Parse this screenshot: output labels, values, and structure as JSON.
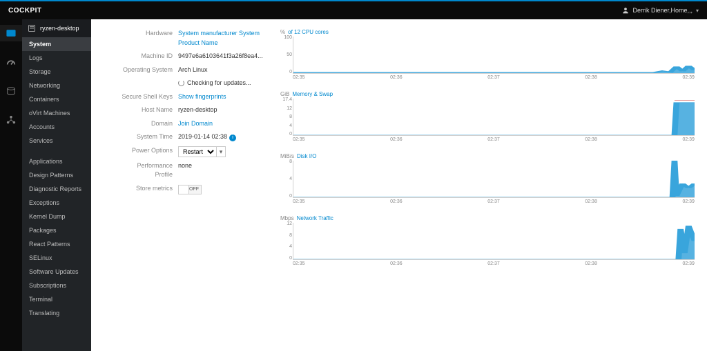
{
  "brand": "COCKPIT",
  "user": {
    "name": "Derrik Diener,Home,,,"
  },
  "sidebar": {
    "hostname": "ryzen-desktop",
    "items": [
      {
        "label": "System",
        "selected": true
      },
      {
        "label": "Logs"
      },
      {
        "label": "Storage"
      },
      {
        "label": "Networking"
      },
      {
        "label": "Containers"
      },
      {
        "label": "oVirt Machines"
      },
      {
        "label": "Accounts"
      },
      {
        "label": "Services"
      },
      {
        "label": "Applications"
      },
      {
        "label": "Design Patterns"
      },
      {
        "label": "Diagnostic Reports"
      },
      {
        "label": "Exceptions"
      },
      {
        "label": "Kernel Dump"
      },
      {
        "label": "Packages"
      },
      {
        "label": "React Patterns"
      },
      {
        "label": "SELinux"
      },
      {
        "label": "Software Updates"
      },
      {
        "label": "Subscriptions"
      },
      {
        "label": "Terminal"
      },
      {
        "label": "Translating"
      }
    ]
  },
  "info": {
    "hardware": {
      "label": "Hardware",
      "value": "System manufacturer System Product Name"
    },
    "machine_id": {
      "label": "Machine ID",
      "value": "9497e6a6103641f3a26f8ea4..."
    },
    "os": {
      "label": "Operating System",
      "value": "Arch Linux"
    },
    "updates": {
      "value": "Checking for updates..."
    },
    "ssh": {
      "label": "Secure Shell Keys",
      "value": "Show fingerprints"
    },
    "hostname": {
      "label": "Host Name",
      "value": "ryzen-desktop"
    },
    "domain": {
      "label": "Domain",
      "value": "Join Domain"
    },
    "systime": {
      "label": "System Time",
      "value": "2019-01-14 02:38"
    },
    "power": {
      "label": "Power Options",
      "value": "Restart"
    },
    "perf": {
      "label": "Performance Profile",
      "value": "none"
    },
    "metrics": {
      "label": "Store metrics",
      "value": "OFF"
    }
  },
  "chart_data": [
    {
      "type": "area",
      "unit": "%",
      "title": "of 12 CPU cores",
      "ylim": [
        0,
        100
      ],
      "yticks": [
        100,
        50,
        0
      ],
      "xticks": [
        "02:35",
        "02:36",
        "02:37",
        "02:38",
        "02:39"
      ],
      "series": [
        {
          "name": "cpu",
          "x": [
            0,
            0.9,
            0.92,
            0.94,
            0.955,
            0.97,
            0.985,
            1.0
          ],
          "y": [
            2,
            2,
            6,
            3,
            18,
            5,
            20,
            8
          ]
        }
      ]
    },
    {
      "type": "area",
      "unit": "GiB",
      "title": "Memory & Swap",
      "ylim": [
        0,
        17.4
      ],
      "yticks": [
        17.4,
        12,
        8,
        4,
        0
      ],
      "xticks": [
        "02:35",
        "02:36",
        "02:37",
        "02:38",
        "02:39"
      ],
      "series": [
        {
          "name": "memory",
          "x": [
            0,
            0.95,
            0.955,
            1.0
          ],
          "y": [
            0,
            0,
            15.5,
            15.5
          ]
        },
        {
          "name": "swap",
          "x": [
            0.95,
            1.0
          ],
          "y": [
            16.5,
            16.5
          ],
          "stroke": "#c9302c"
        }
      ]
    },
    {
      "type": "area",
      "unit": "MiB/s",
      "title": "Disk I/O",
      "ylim": [
        0,
        8
      ],
      "yticks": [
        8,
        4,
        0
      ],
      "xticks": [
        "02:35",
        "02:36",
        "02:37",
        "02:38",
        "02:39"
      ],
      "series": [
        {
          "name": "io",
          "x": [
            0,
            0.945,
            0.95,
            0.955,
            0.97,
            0.985,
            1.0
          ],
          "y": [
            0,
            0,
            8,
            0.3,
            3,
            2,
            3
          ]
        }
      ]
    },
    {
      "type": "area",
      "unit": "Mbps",
      "title": "Network Traffic",
      "ylim": [
        0,
        12
      ],
      "yticks": [
        12,
        8,
        4,
        0
      ],
      "xticks": [
        "02:35",
        "02:36",
        "02:37",
        "02:38",
        "02:39"
      ],
      "series": [
        {
          "name": "net",
          "x": [
            0,
            0.96,
            0.965,
            0.975,
            0.985,
            1.0
          ],
          "y": [
            0,
            0,
            10,
            2,
            11,
            6
          ]
        }
      ]
    }
  ]
}
